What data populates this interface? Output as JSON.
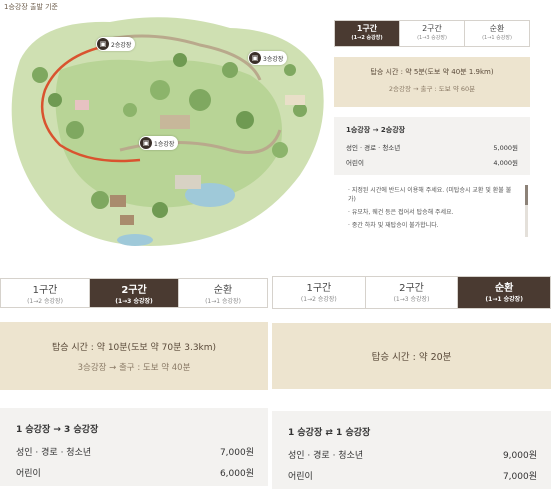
{
  "map": {
    "title": "1승강장 출발 기준",
    "stations": [
      {
        "label": "1승강장",
        "icon": "bus-icon"
      },
      {
        "label": "2승강장",
        "icon": "bus-icon"
      },
      {
        "label": "3승강장",
        "icon": "bus-icon"
      }
    ]
  },
  "panel_top": {
    "tabs": [
      {
        "label": "1구간",
        "sub": "(1→2 승강장)",
        "active": true
      },
      {
        "label": "2구간",
        "sub": "(1→3 승강장)",
        "active": false
      },
      {
        "label": "순환",
        "sub": "(1→1 승강장)",
        "active": false
      }
    ],
    "time": "탑승 시간 : 약 5분(도보 약 40분 1.9km)",
    "route": "2승강장 → 출구 : 도보 약 60분",
    "fare_route": "1승강장 → 2승강장",
    "fares": [
      {
        "label": "성인 · 경로 · 청소년",
        "price": "5,000원"
      },
      {
        "label": "어린이",
        "price": "4,000원"
      }
    ],
    "notes": [
      "지정된 시간에 반드시 이용해 주세요. (미탑승시 교환 및 환불 불가)",
      "유모차, 웨건 등은 접어서 탑승해 주세요.",
      "중간 하차 및 재탑승이 불가합니다."
    ]
  },
  "panel_left": {
    "tabs": [
      {
        "label": "1구간",
        "sub": "(1→2 승강장)",
        "active": false
      },
      {
        "label": "2구간",
        "sub": "(1→3 승강장)",
        "active": true
      },
      {
        "label": "순환",
        "sub": "(1→1 승강장)",
        "active": false
      }
    ],
    "time": "탑승 시간 : 약 10분(도보 약 70분 3.3km)",
    "route": "3승강장 → 출구 : 도보 약 40분",
    "fare_route": "1 승강장 → 3 승강장",
    "fares": [
      {
        "label": "성인 · 경로 · 청소년",
        "price": "7,000원"
      },
      {
        "label": "어린이",
        "price": "6,000원"
      }
    ]
  },
  "panel_right": {
    "tabs": [
      {
        "label": "1구간",
        "sub": "(1→2 승강장)",
        "active": false
      },
      {
        "label": "2구간",
        "sub": "(1→3 승강장)",
        "active": false
      },
      {
        "label": "순환",
        "sub": "(1→1 승강장)",
        "active": true
      }
    ],
    "time": "탑승 시간 : 약 20분",
    "fare_route": "1 승강장 ⇄ 1 승강장",
    "fares": [
      {
        "label": "성인 · 경로 · 청소년",
        "price": "9,000원"
      },
      {
        "label": "어린이",
        "price": "7,000원"
      }
    ]
  }
}
